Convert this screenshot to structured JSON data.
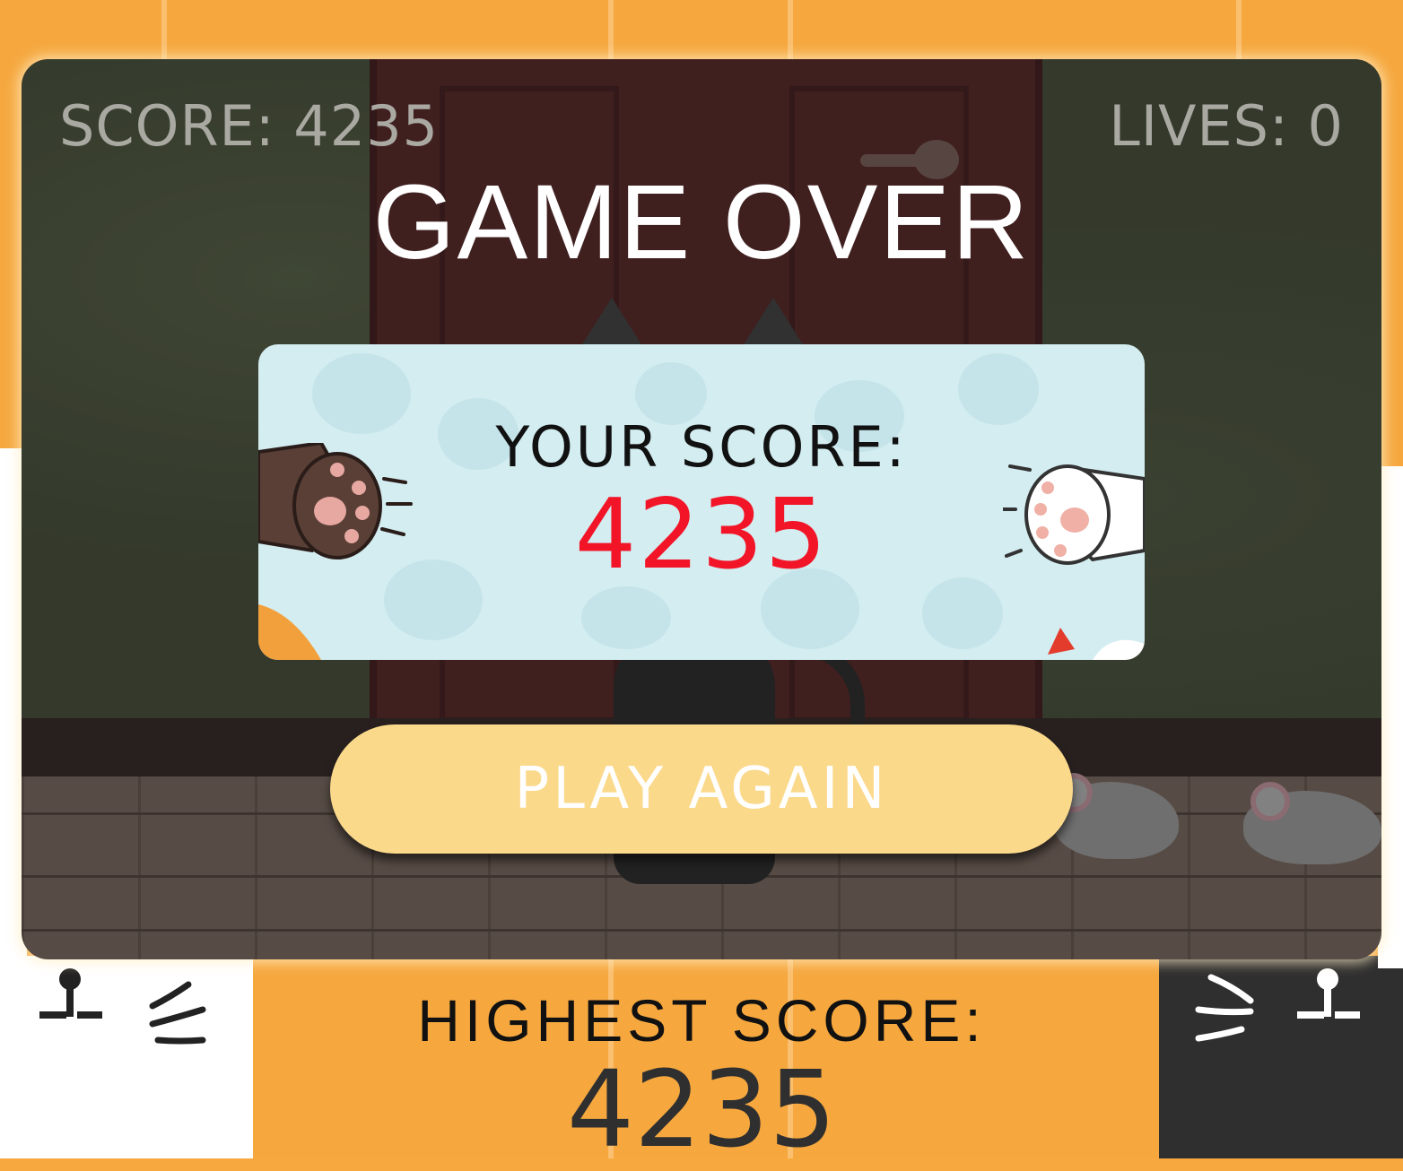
{
  "hud": {
    "score_text": "SCORE: 4235",
    "lives_text": "LIVES: 0"
  },
  "game_over": {
    "title": "GAME OVER"
  },
  "score_card": {
    "label": "YOUR SCORE:",
    "value": "4235"
  },
  "actions": {
    "play_again_label": "PLAY AGAIN"
  },
  "highest": {
    "label": "HIGHEST SCORE:",
    "value": "4235"
  },
  "colors": {
    "frame_orange": "#f6a83f",
    "score_value_red": "#f21528",
    "button_yellow": "#fbd98b",
    "card_blue": "#d3edf1"
  }
}
